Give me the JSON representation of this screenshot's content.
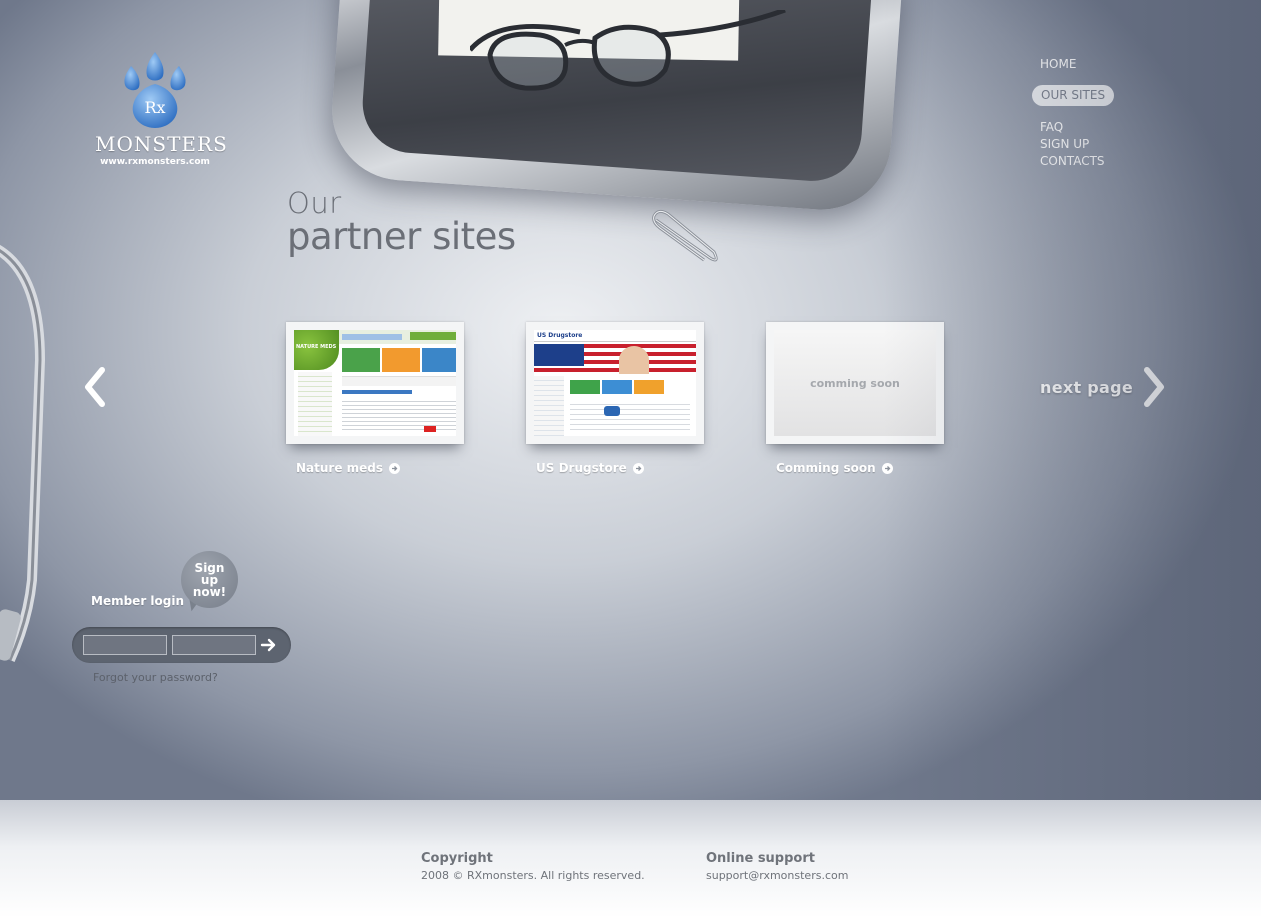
{
  "brand": {
    "logo_mark": "Rx",
    "name": "MONSTERS",
    "url": "www.rxmonsters.com"
  },
  "nav": {
    "items": [
      {
        "label": "HOME",
        "active": false
      },
      {
        "label": "OUR SITES",
        "active": true
      },
      {
        "label": "FAQ",
        "active": false
      },
      {
        "label": "SIGN UP",
        "active": false
      },
      {
        "label": "CONTACTS",
        "active": false
      }
    ]
  },
  "heading": {
    "line1": "Our",
    "line2": "partner sites"
  },
  "carousel": {
    "prev_icon": "chevron-left-icon",
    "next_label": "next page",
    "next_icon": "chevron-right-icon",
    "cards": [
      {
        "label": "Nature meds",
        "thumb_title": "NATURE MEDS"
      },
      {
        "label": "US Drugstore",
        "thumb_title": "US Drugstore"
      },
      {
        "label": "Comming soon",
        "thumb_text": "comming soon"
      }
    ]
  },
  "login": {
    "title": "Member login",
    "signup_bubble": [
      "Sign",
      "up",
      "now!"
    ],
    "username_value": "",
    "password_value": "",
    "submit_icon": "arrow-right-icon",
    "forgot_label": "Forgot your password?"
  },
  "footer": {
    "copyright_title": "Copyright",
    "copyright_text": "2008 © RXmonsters. All rights reserved.",
    "support_title": "Online support",
    "support_email": "support@rxmonsters.com"
  },
  "colors": {
    "logo_blue": "#3b79c9",
    "text_gray": "#6f737a",
    "active_nav_bg": "#eceef1"
  }
}
